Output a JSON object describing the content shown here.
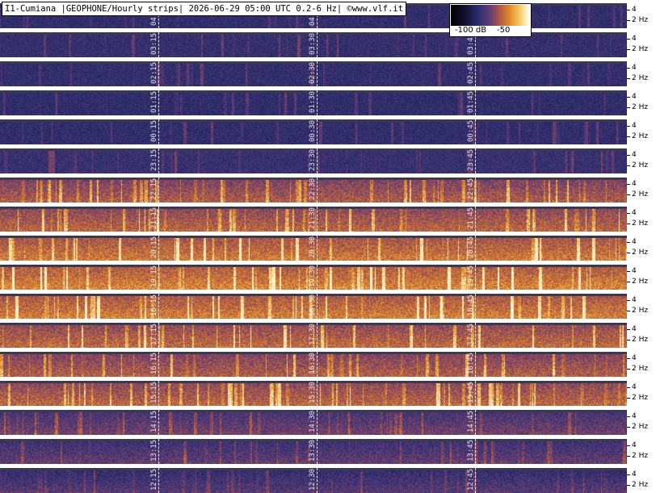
{
  "title": "I1-Cumiana |GEOPHONE/Hourly strips| 2026-06-29 05:00 UTC 0.2-6 Hz| ©www.vlf.it",
  "colorbar": {
    "min_label": "-100 dB",
    "max_label": "-50"
  },
  "axis": {
    "upper_label": "4",
    "lower_label": "2 Hz"
  },
  "strips": [
    {
      "labels": [
        "04:15",
        "04:30",
        "04:45"
      ],
      "intensity": 0.15
    },
    {
      "labels": [
        "03:15",
        "03:30",
        "03:45"
      ],
      "intensity": 0.18
    },
    {
      "labels": [
        "02:15",
        "02:30",
        "02:45"
      ],
      "intensity": 0.16
    },
    {
      "labels": [
        "01:15",
        "01:30",
        "01:45"
      ],
      "intensity": 0.14
    },
    {
      "labels": [
        "00:15",
        "00:30",
        "00:45"
      ],
      "intensity": 0.15
    },
    {
      "labels": [
        "23:15",
        "23:30",
        "23:45"
      ],
      "intensity": 0.2
    },
    {
      "labels": [
        "22:15",
        "22:30",
        "22:45"
      ],
      "intensity": 0.65
    },
    {
      "labels": [
        "21:15",
        "21:30",
        "21:45"
      ],
      "intensity": 0.7
    },
    {
      "labels": [
        "20:15",
        "20:30",
        "20:45"
      ],
      "intensity": 0.78
    },
    {
      "labels": [
        "19:15",
        "19:30",
        "19:45"
      ],
      "intensity": 0.82
    },
    {
      "labels": [
        "18:15",
        "18:30",
        "18:45"
      ],
      "intensity": 0.8
    },
    {
      "labels": [
        "17:15",
        "17:30",
        "17:45"
      ],
      "intensity": 0.72
    },
    {
      "labels": [
        "16:15",
        "16:30",
        "16:45"
      ],
      "intensity": 0.66
    },
    {
      "labels": [
        "15:15",
        "15:30",
        "15:45"
      ],
      "intensity": 0.7
    },
    {
      "labels": [
        "14:15",
        "14:30",
        "14:45"
      ],
      "intensity": 0.45
    },
    {
      "labels": [
        "13:15",
        "13:30",
        "13:45"
      ],
      "intensity": 0.4
    },
    {
      "labels": [
        "12:15",
        "12:30",
        "12:45"
      ],
      "intensity": 0.35
    }
  ]
}
